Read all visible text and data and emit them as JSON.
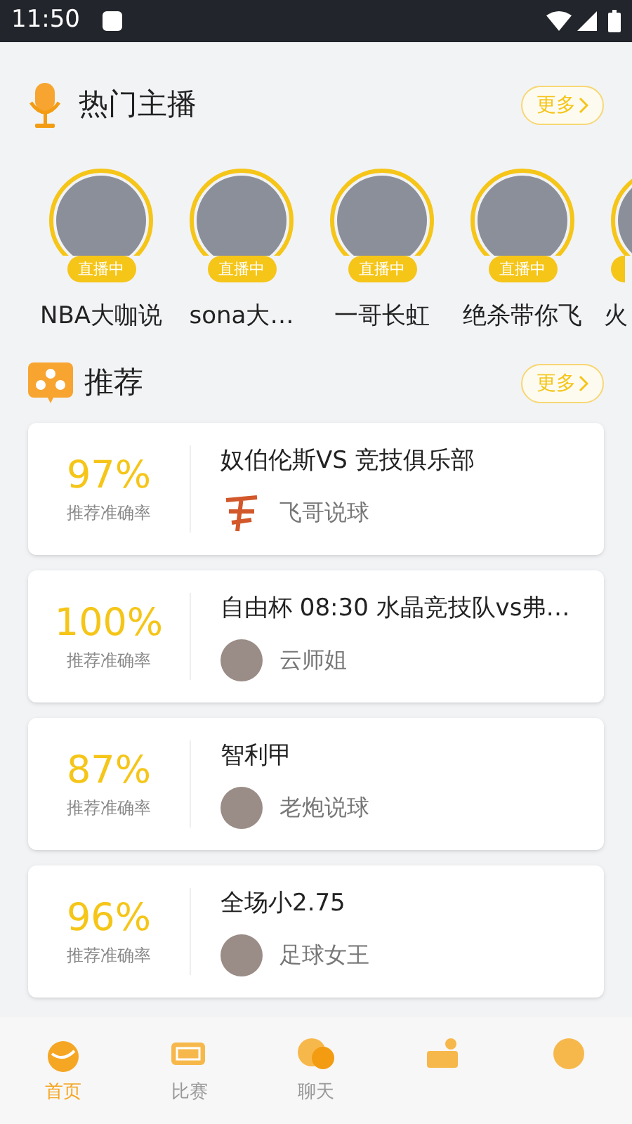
{
  "status_bar": {
    "time": "11:50"
  },
  "hot_anchors": {
    "title": "热门主播",
    "more": "更多",
    "items": [
      {
        "name": "NBA大咖说",
        "badge": "直播中"
      },
      {
        "name": "sona大…",
        "badge": "直播中"
      },
      {
        "name": "一哥长虹",
        "badge": "直播中"
      },
      {
        "name": "绝杀带你飞",
        "badge": "直播中"
      },
      {
        "name": "火"
      }
    ]
  },
  "recommend": {
    "title": "推荐",
    "more": "更多",
    "items": [
      {
        "rate": "97%",
        "rate_label": "推荐准确率",
        "title": "奴伯伦斯VS 竞技俱乐部",
        "author": "飞哥说球",
        "kind": "logo"
      },
      {
        "rate": "100%",
        "rate_label": "推荐准确率",
        "title": "自由杯 08:30 水晶竞技队vs弗…",
        "author": "云师姐",
        "kind": "photo"
      },
      {
        "rate": "87%",
        "rate_label": "推荐准确率",
        "title": "智利甲",
        "author": "老炮说球",
        "kind": "photo"
      },
      {
        "rate": "96%",
        "rate_label": "推荐准确率",
        "title": "全场小2.75",
        "author": "足球女王",
        "kind": "photo"
      }
    ]
  },
  "bottom_nav": [
    {
      "label": "首页",
      "selected": true
    },
    {
      "label": "比赛",
      "selected": false
    },
    {
      "label": "聊天",
      "selected": false
    },
    {
      "selected": false
    },
    {
      "selected": false
    }
  ]
}
